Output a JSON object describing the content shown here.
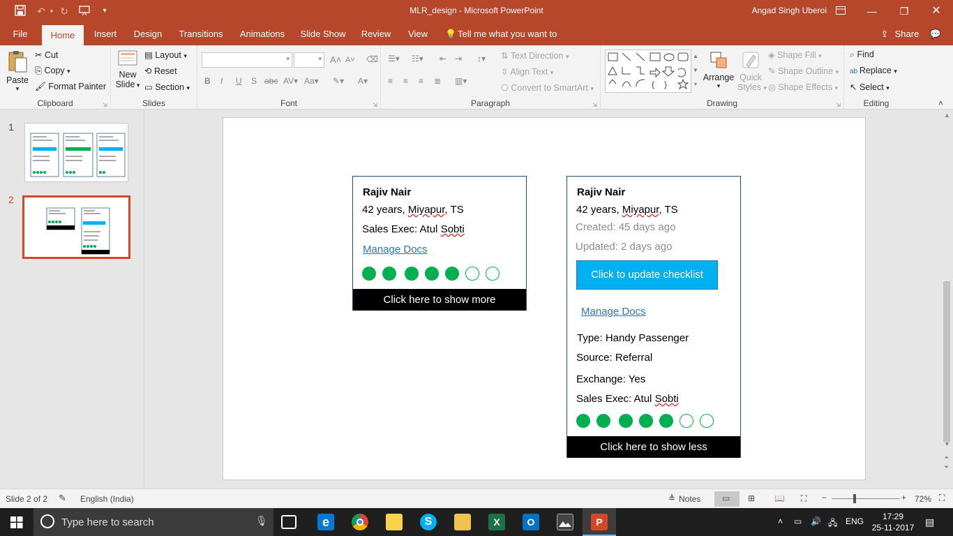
{
  "window": {
    "title": "MLR_design  -  Microsoft PowerPoint",
    "user": "Angad Singh Uberoi"
  },
  "tabs": {
    "file": "File",
    "home": "Home",
    "insert": "Insert",
    "design": "Design",
    "transitions": "Transitions",
    "animations": "Animations",
    "slideshow": "Slide Show",
    "review": "Review",
    "view": "View",
    "tellme": "Tell me what you want to do",
    "share": "Share"
  },
  "ribbon": {
    "clipboard": {
      "label": "Clipboard",
      "paste": "Paste",
      "cut": "Cut",
      "copy": "Copy",
      "format_painter": "Format Painter"
    },
    "slides": {
      "label": "Slides",
      "new_slide_1": "New",
      "new_slide_2": "Slide",
      "layout": "Layout",
      "reset": "Reset",
      "section": "Section"
    },
    "font": {
      "label": "Font",
      "font_name": "",
      "font_size": ""
    },
    "paragraph": {
      "label": "Paragraph",
      "text_direction": "Text Direction",
      "align_text": "Align Text",
      "convert_smartart": "Convert to SmartArt"
    },
    "drawing": {
      "label": "Drawing",
      "arrange": "Arrange",
      "quick_styles_1": "Quick",
      "quick_styles_2": "Styles",
      "shape_fill": "Shape Fill",
      "shape_outline": "Shape Outline",
      "shape_effects": "Shape Effects"
    },
    "editing": {
      "label": "Editing",
      "find": "Find",
      "replace": "Replace",
      "select": "Select"
    }
  },
  "thumbnails": {
    "slide1": "1",
    "slide2": "2"
  },
  "slide": {
    "card1": {
      "name": "Rajiv Nair",
      "age": "42 years, ",
      "location": "Miyapur",
      "state": ", TS",
      "sales_prefix": "Sales Exec: Atul ",
      "sales_name": "Sobti",
      "manage_docs": "Manage Docs",
      "show_more": "Click here to show more",
      "progress_filled": 5,
      "progress_total": 7
    },
    "card2": {
      "name": "Rajiv Nair",
      "age": "42 years, ",
      "location": "Miyapur",
      "state": ", TS",
      "created": "Created: 45 days ago",
      "updated": "Updated: 2 days ago",
      "checklist_button": "Click to update checklist",
      "manage_docs": "Manage Docs",
      "type": "Type: Handy Passenger",
      "source": "Source: Referral",
      "exchange": "Exchange: Yes",
      "sales_prefix": "Sales Exec: Atul ",
      "sales_name": "Sobti",
      "show_less": "Click here to show less",
      "progress_filled": 5,
      "progress_total": 7
    }
  },
  "status": {
    "slide_count": "Slide 2 of 2",
    "language": "English (India)",
    "notes": "Notes",
    "zoom": "72%"
  },
  "taskbar": {
    "search_placeholder": "Type here to search",
    "lang": "ENG",
    "time": "17:29",
    "date": "25-11-2017"
  },
  "colors": {
    "brand": "#b7472a",
    "progress_green": "#00b050",
    "button_blue": "#00b0f0",
    "link": "#2e75b6"
  }
}
